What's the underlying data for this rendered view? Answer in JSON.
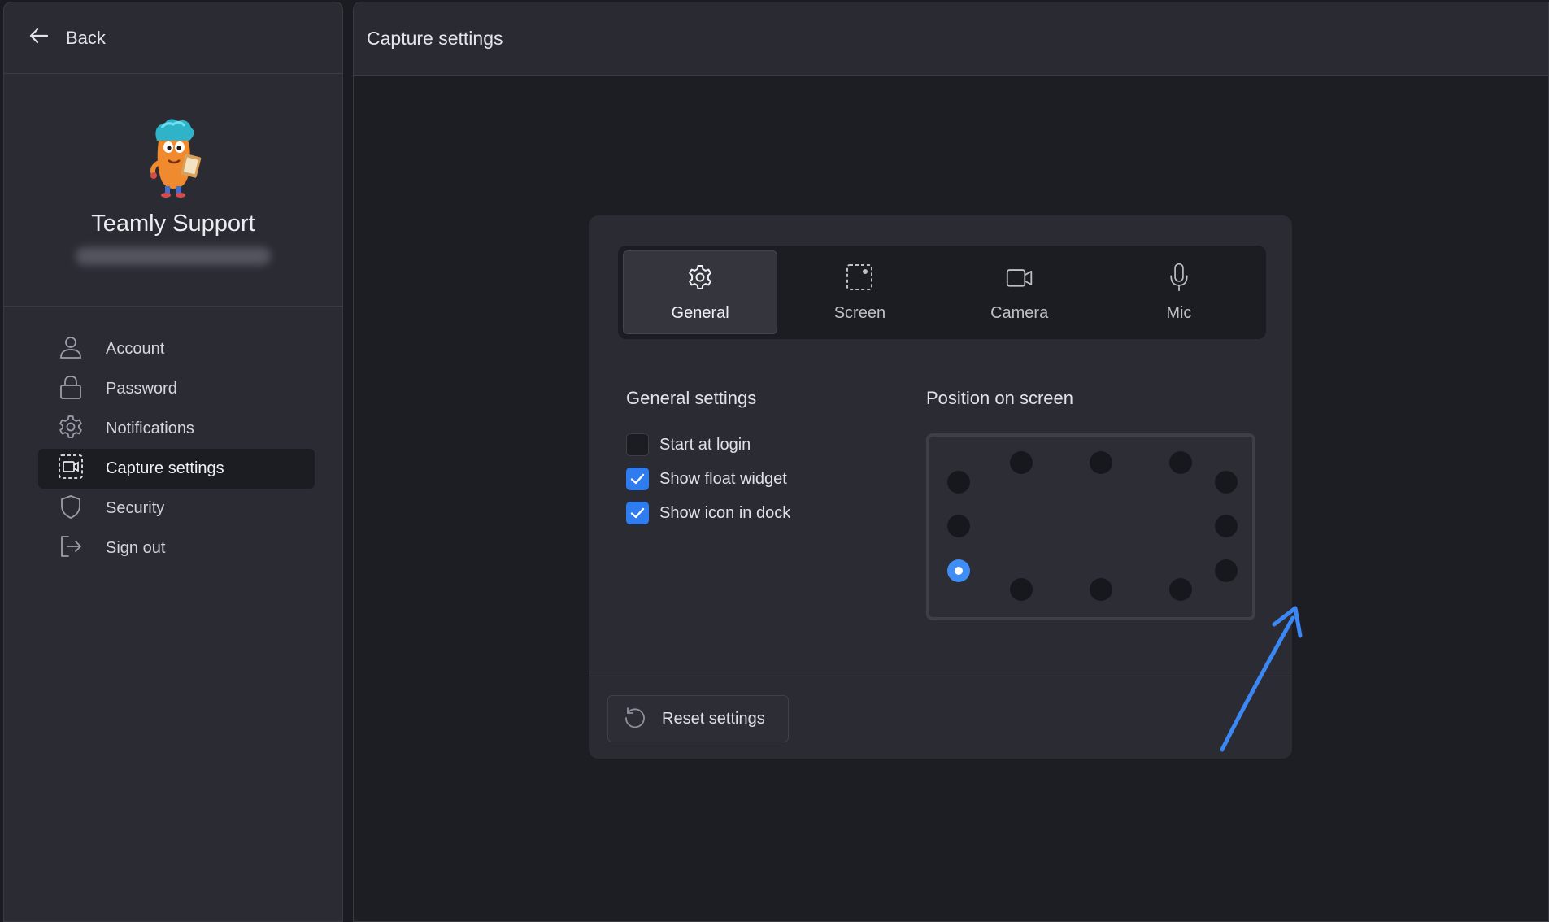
{
  "sidebar": {
    "back_label": "Back",
    "profile": {
      "name": "Teamly Support"
    },
    "nav": [
      {
        "label": "Account",
        "icon": "user-icon"
      },
      {
        "label": "Password",
        "icon": "lock-icon"
      },
      {
        "label": "Notifications",
        "icon": "gear-icon"
      },
      {
        "label": "Capture settings",
        "icon": "capture-icon",
        "active": true
      },
      {
        "label": "Security",
        "icon": "shield-icon"
      },
      {
        "label": "Sign out",
        "icon": "sign-out-icon"
      }
    ]
  },
  "main": {
    "title": "Capture settings",
    "tabs": [
      {
        "label": "General",
        "icon": "gear-icon",
        "active": true
      },
      {
        "label": "Screen",
        "icon": "screen-select-icon"
      },
      {
        "label": "Camera",
        "icon": "camera-icon"
      },
      {
        "label": "Mic",
        "icon": "mic-icon"
      }
    ],
    "general": {
      "title": "General settings",
      "options": [
        {
          "label": "Start at login",
          "checked": false
        },
        {
          "label": "Show float widget",
          "checked": true
        },
        {
          "label": "Show icon in dock",
          "checked": true
        }
      ]
    },
    "position": {
      "title": "Position on screen",
      "selected": "left-bottom"
    },
    "reset_label": "Reset settings"
  },
  "colors": {
    "accent": "#2f7bf0",
    "selected_dot": "#3f8ef5",
    "annotation_arrow": "#3b87f5"
  }
}
